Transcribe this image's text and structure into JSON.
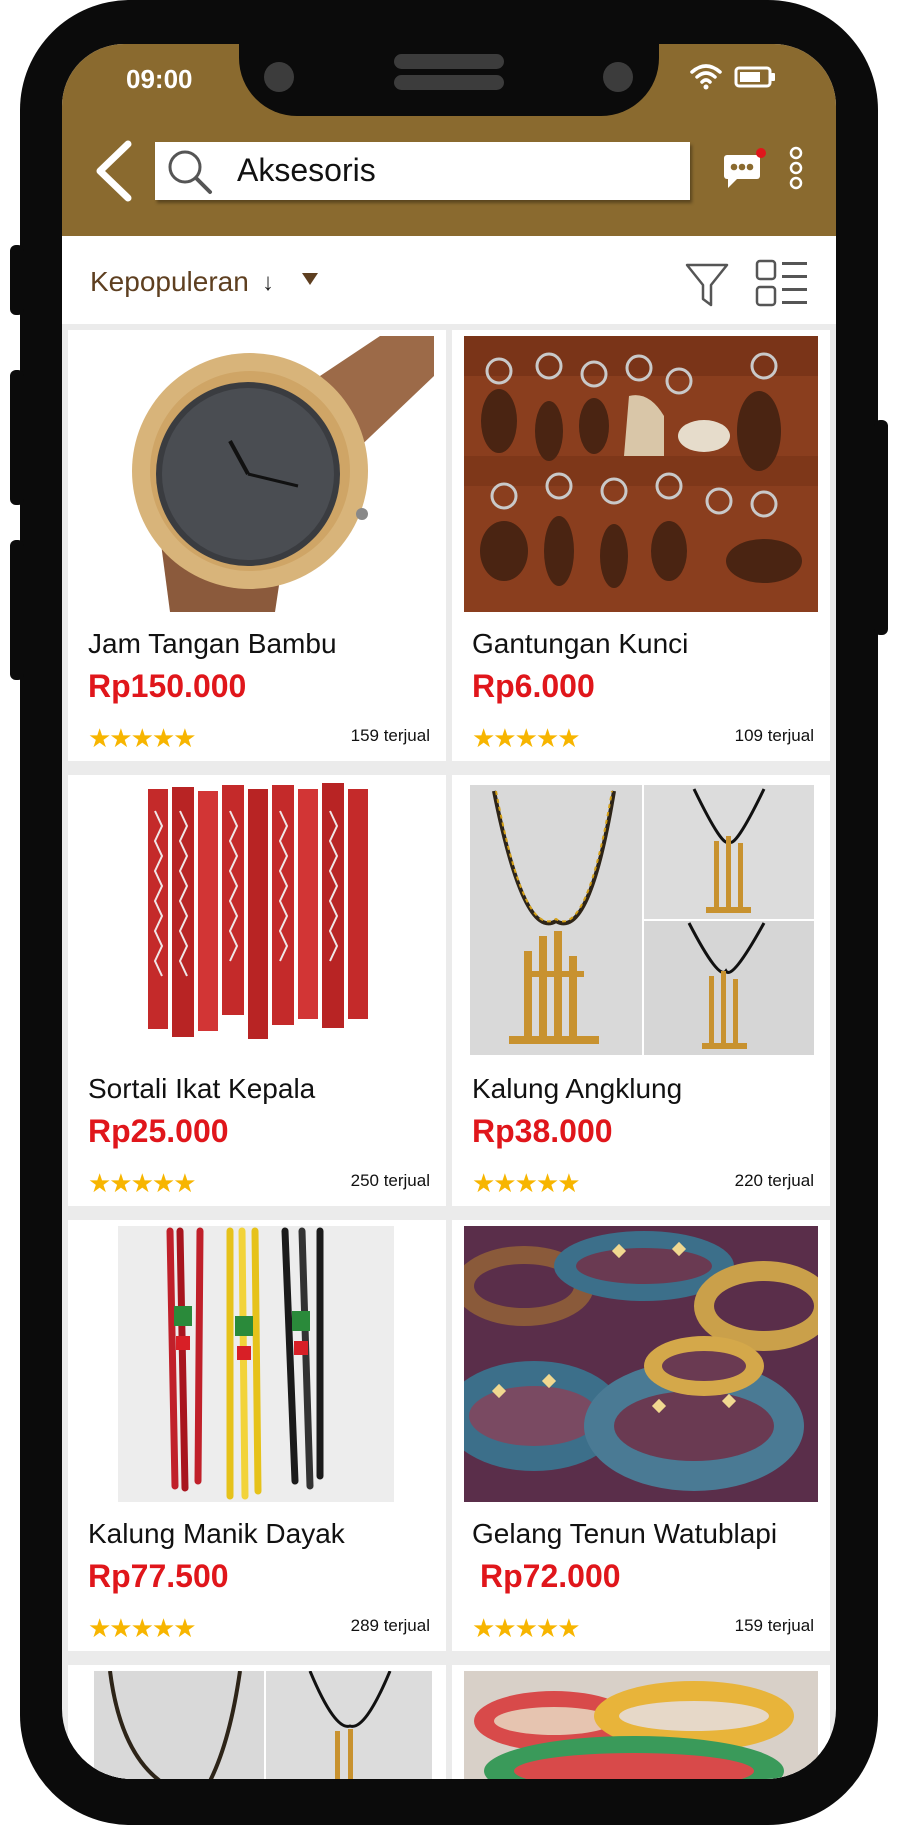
{
  "status_bar": {
    "time": "09:00",
    "wifi_icon": "wifi-icon",
    "battery_icon": "battery-icon"
  },
  "header": {
    "back_icon": "chevron-left-icon",
    "search_icon": "search-icon",
    "search_value": "Aksesoris",
    "chat_icon": "chat-icon",
    "more_icon": "more-vertical-icon"
  },
  "sortbar": {
    "label": "Kepopuleran",
    "arrow": "↓",
    "filter_icon": "filter-icon",
    "layout_icon": "list-layout-icon"
  },
  "colors": {
    "header": "#8a6a2f",
    "price": "#e0161b",
    "star": "#f7b500",
    "sort_label": "#5e3f20"
  },
  "products": [
    {
      "name": "Jam Tangan Bambu",
      "price": "Rp150.000",
      "rating": 5,
      "stars": "★★★★★",
      "sold": "159 terjual"
    },
    {
      "name": "Gantungan Kunci",
      "price": "Rp6.000",
      "rating": 5,
      "stars": "★★★★★",
      "sold": "109 terjual"
    },
    {
      "name": "Sortali Ikat Kepala",
      "price": "Rp25.000",
      "rating": 5,
      "stars": "★★★★★",
      "sold": "250 terjual"
    },
    {
      "name": "Kalung Angklung",
      "price": "Rp38.000",
      "rating": 5,
      "stars": "★★★★★",
      "sold": "220 terjual"
    },
    {
      "name": "Kalung Manik Dayak",
      "price": "Rp77.500",
      "rating": 5,
      "stars": "★★★★★",
      "sold": "289 terjual"
    },
    {
      "name": "Gelang Tenun Watublapi",
      "price": "Rp72.000",
      "rating": 5,
      "stars": "★★★★★",
      "sold": "159 terjual"
    }
  ]
}
